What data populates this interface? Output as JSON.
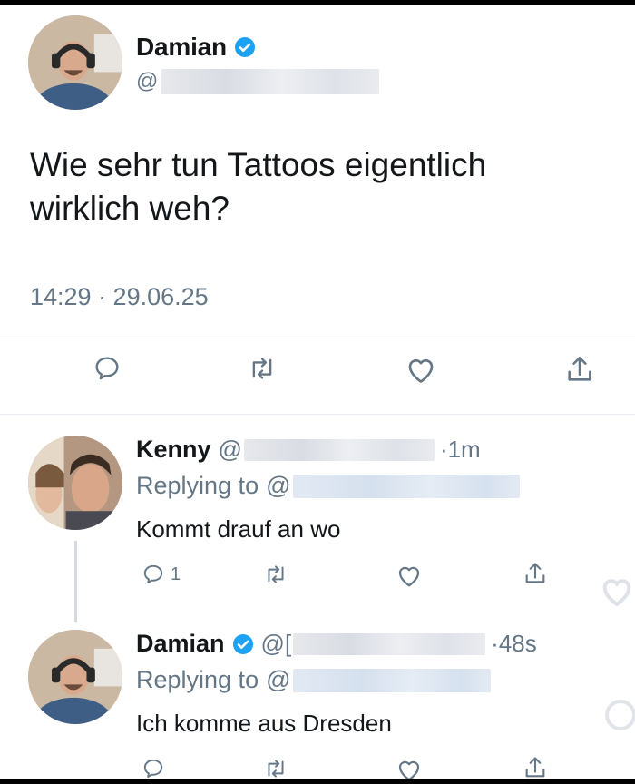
{
  "main_tweet": {
    "author_name": "Damian",
    "handle_prefix": "@",
    "text": "Wie sehr tun Tattoos eigentlich wirklich weh?",
    "timestamp": "14:29 · 29.06.25",
    "verified": true
  },
  "replies": [
    {
      "author_name": "Kenny",
      "handle_prefix": "@",
      "time": "·1m",
      "replying_to_label": "Replying to",
      "replying_to_prefix": "@",
      "text": "Kommt drauf an wo",
      "reply_count": "1",
      "verified": false
    },
    {
      "author_name": "Damian",
      "handle_prefix": "@[",
      "time": "·48s",
      "replying_to_label": "Replying to",
      "replying_to_prefix": "@",
      "text": "Ich komme aus Dresden",
      "verified": true
    }
  ],
  "icons": {
    "reply": "speech-bubble-icon",
    "retweet": "retweet-icon",
    "like": "heart-icon",
    "share": "share-icon",
    "verified": "verified-badge-icon"
  },
  "colors": {
    "verified_blue": "#1da1f2",
    "secondary_text": "#657786",
    "primary_text": "#14171a",
    "divider": "#e6ecf0"
  }
}
